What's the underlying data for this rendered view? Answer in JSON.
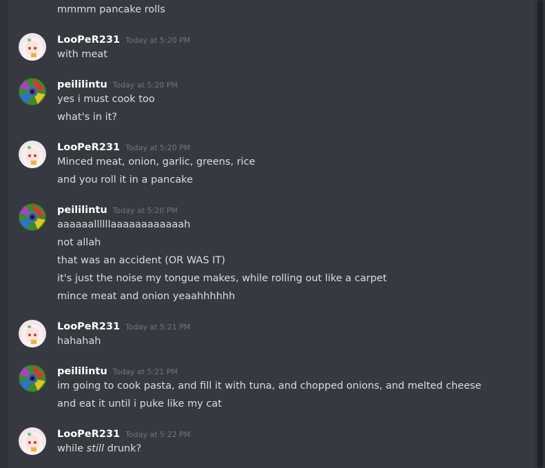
{
  "messages": [
    {
      "type": "continuation",
      "text": "mmmm pancake rolls"
    },
    {
      "type": "group",
      "author": "LooPeR231",
      "avatar": "anime-girl-avatar",
      "timestamp": "Today at 5:20 PM",
      "lines": [
        "with meat"
      ]
    },
    {
      "type": "group",
      "author": "peililintu",
      "avatar": "psychedelic-spiral-avatar",
      "timestamp": "Today at 5:20 PM",
      "lines": [
        "yes i must cook too",
        "what's in it?"
      ]
    },
    {
      "type": "group",
      "author": "LooPeR231",
      "avatar": "anime-girl-avatar",
      "timestamp": "Today at 5:20 PM",
      "lines": [
        "Minced meat, onion, garlic, greens, rice",
        "and you roll it in a pancake"
      ]
    },
    {
      "type": "group",
      "author": "peililintu",
      "avatar": "psychedelic-spiral-avatar",
      "timestamp": "Today at 5:20 PM",
      "lines": [
        "aaaaaallllllaaaaaaaaaaaah",
        "not allah",
        "that was an accident (OR WAS IT)",
        "it's just the noise my tongue makes, while rolling out like a carpet",
        "mince meat and onion yeaahhhhhh"
      ]
    },
    {
      "type": "group",
      "author": "LooPeR231",
      "avatar": "anime-girl-avatar",
      "timestamp": "Today at 5:21 PM",
      "lines": [
        "hahahah"
      ]
    },
    {
      "type": "group",
      "author": "peililintu",
      "avatar": "psychedelic-spiral-avatar",
      "timestamp": "Today at 5:21 PM",
      "lines": [
        "im going to cook pasta, and fill it with tuna, and chopped onions, and melted cheese",
        "and eat it until i puke like my cat"
      ]
    },
    {
      "type": "group",
      "author": "LooPeR231",
      "avatar": "anime-girl-avatar",
      "timestamp": "Today at 5:22 PM",
      "last_line": {
        "before": "while ",
        "emphasis": "still",
        "after": " drunk?"
      }
    }
  ]
}
